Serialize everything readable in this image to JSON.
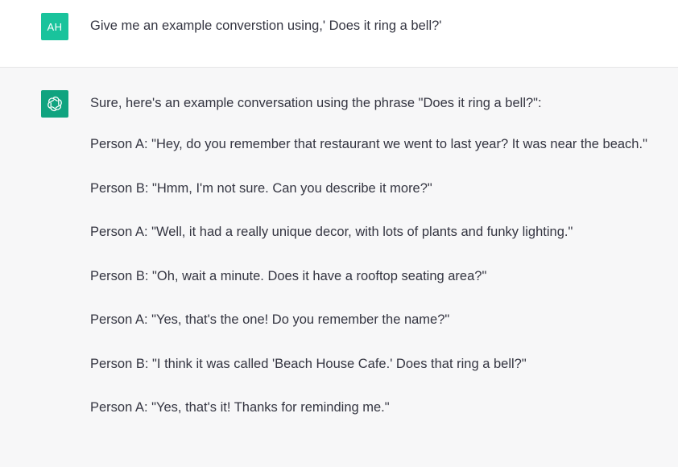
{
  "user_message": {
    "avatar_initials": "AH",
    "avatar_color": "#19c39c",
    "text": "Give me an example converstion using,' Does it ring a bell?'"
  },
  "assistant_message": {
    "avatar_icon": "openai-logo-icon",
    "avatar_color": "#10a37f",
    "paragraphs": [
      "Sure, here's an example conversation using the phrase \"Does it ring a bell?\":",
      "Person A: \"Hey, do you remember that restaurant we went to last year? It was near the beach.\"",
      "Person B: \"Hmm, I'm not sure. Can you describe it more?\"",
      "Person A: \"Well, it had a really unique decor, with lots of plants and funky lighting.\"",
      "Person B: \"Oh, wait a minute. Does it have a rooftop seating area?\"",
      "Person A: \"Yes, that's the one! Do you remember the name?\"",
      "Person B: \"I think it was called 'Beach House Cafe.' Does that ring a bell?\"",
      "Person A: \"Yes, that's it! Thanks for reminding me.\""
    ]
  }
}
